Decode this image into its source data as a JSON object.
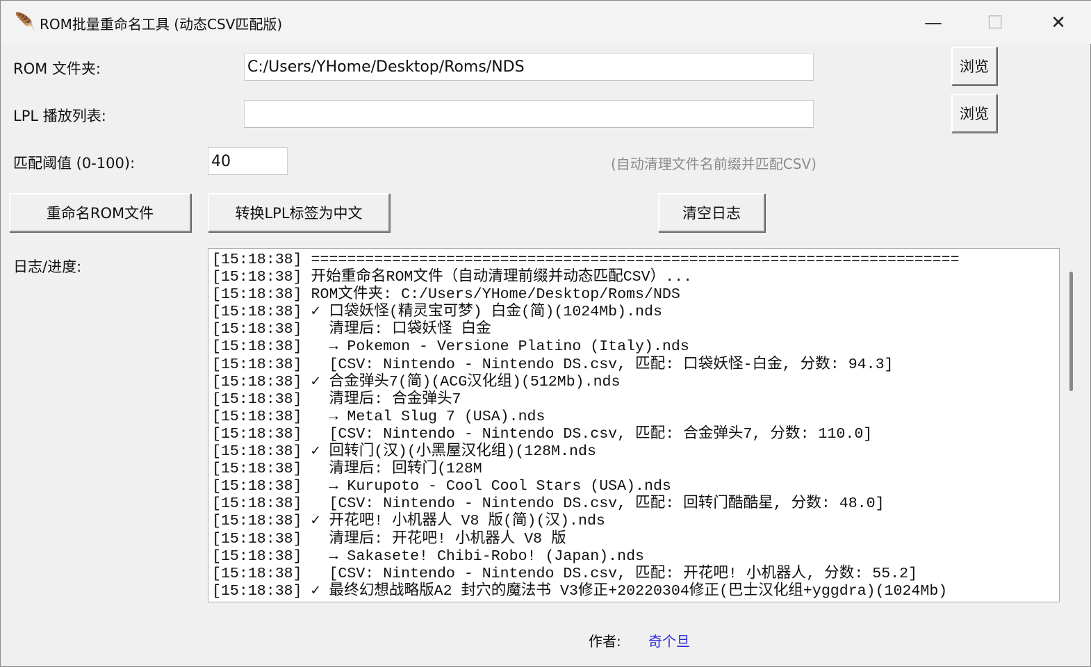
{
  "window": {
    "title": "ROM批量重命名工具 (动态CSV匹配版)",
    "minimize": "—",
    "maximize": "☐",
    "close": "✕"
  },
  "form": {
    "rom_label": "ROM 文件夹:",
    "rom_value": "C:/Users/YHome/Desktop/Roms/NDS",
    "browse1": "浏览",
    "lpl_label": "LPL 播放列表:",
    "lpl_value": "",
    "browse2": "浏览",
    "threshold_label": "匹配阈值 (0-100):",
    "threshold_value": "40",
    "hint": "(自动清理文件名前缀并匹配CSV)"
  },
  "buttons": {
    "rename": "重命名ROM文件",
    "convert": "转换LPL标签为中文",
    "clear": "清空日志"
  },
  "log": {
    "label": "日志/进度:",
    "lines": [
      "[15:18:38] ========================================================================",
      "[15:18:38] 开始重命名ROM文件（自动清理前缀并动态匹配CSV）...",
      "[15:18:38] ROM文件夹: C:/Users/YHome/Desktop/Roms/NDS",
      "[15:18:38] ✓ 口袋妖怪(精灵宝可梦) 白金(简)(1024Mb).nds",
      "[15:18:38]   清理后: 口袋妖怪 白金",
      "[15:18:38]   → Pokemon - Versione Platino (Italy).nds",
      "[15:18:38]   [CSV: Nintendo - Nintendo DS.csv, 匹配: 口袋妖怪-白金, 分数: 94.3]",
      "[15:18:38] ✓ 合金弹头7(简)(ACG汉化组)(512Mb).nds",
      "[15:18:38]   清理后: 合金弹头7",
      "[15:18:38]   → Metal Slug 7 (USA).nds",
      "[15:18:38]   [CSV: Nintendo - Nintendo DS.csv, 匹配: 合金弹头7, 分数: 110.0]",
      "[15:18:38] ✓ 回转门(汉)(小黑屋汉化组)(128M.nds",
      "[15:18:38]   清理后: 回转门(128M",
      "[15:18:38]   → Kurupoto - Cool Cool Stars (USA).nds",
      "[15:18:38]   [CSV: Nintendo - Nintendo DS.csv, 匹配: 回转门酷酷星, 分数: 48.0]",
      "[15:18:38] ✓ 开花吧! 小机器人 V8 版(简)(汉).nds",
      "[15:18:38]   清理后: 开花吧! 小机器人 V8 版",
      "[15:18:38]   → Sakasete! Chibi-Robo! (Japan).nds",
      "[15:18:38]   [CSV: Nintendo - Nintendo DS.csv, 匹配: 开花吧! 小机器人, 分数: 55.2]",
      "[15:18:38] ✓ 最终幻想战略版A2 封穴的魔法书 V3修正+20220304修正(巴士汉化组+yggdra)(1024Mb)"
    ]
  },
  "footer": {
    "author_label": "作者:",
    "author_name": "奇个旦",
    "author_color": "#2a2adb"
  }
}
